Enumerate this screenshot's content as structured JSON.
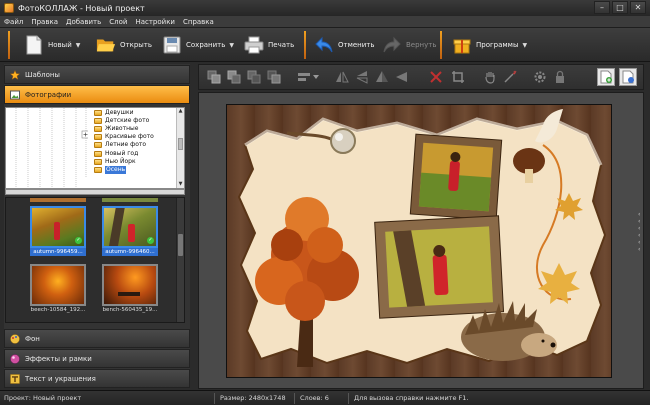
{
  "window": {
    "title": "ФотоКОЛЛАЖ - Новый проект",
    "min": "–",
    "max": "□",
    "close": "✕"
  },
  "menu": [
    "Файл",
    "Правка",
    "Добавить",
    "Слой",
    "Настройки",
    "Справка"
  ],
  "toolbar": {
    "new_label": "Новый",
    "open_label": "Открыть",
    "save_label": "Сохранить",
    "print_label": "Печать",
    "undo_label": "Отменить",
    "redo_label": "Вернуть",
    "programs_label": "Программы",
    "dropdown_glyph": "▼"
  },
  "left_panel": {
    "templates": "Шаблоны",
    "photos": "Фотографии",
    "background": "Фон",
    "effects": "Эффекты и рамки",
    "text": "Текст и украшения"
  },
  "folders": [
    {
      "label": "Девушки",
      "selected": false
    },
    {
      "label": "Детские фото",
      "selected": false
    },
    {
      "label": "Животные",
      "selected": false
    },
    {
      "label": "Красивые фото",
      "selected": false
    },
    {
      "label": "Летние фото",
      "selected": false
    },
    {
      "label": "Новый год",
      "selected": false
    },
    {
      "label": "Нью Йорк",
      "selected": false
    },
    {
      "label": "Осень",
      "selected": true
    }
  ],
  "thumbnails": [
    {
      "label": "autumn-996459...",
      "selected": true,
      "checked": true
    },
    {
      "label": "autumn-996460...",
      "selected": true,
      "checked": true
    },
    {
      "label": "beech-10584_192...",
      "selected": false,
      "checked": false
    },
    {
      "label": "bench-560435_19...",
      "selected": false,
      "checked": false
    }
  ],
  "status": {
    "project": "Проект:  Новый проект",
    "size": "Размер:  2480x1748",
    "layers": "Слоев:  6",
    "help": "Для вызова справки нажмите F1."
  },
  "colors": {
    "accent": "#f0a020",
    "selection": "#3a78d8",
    "background": "#2b2b2b"
  }
}
